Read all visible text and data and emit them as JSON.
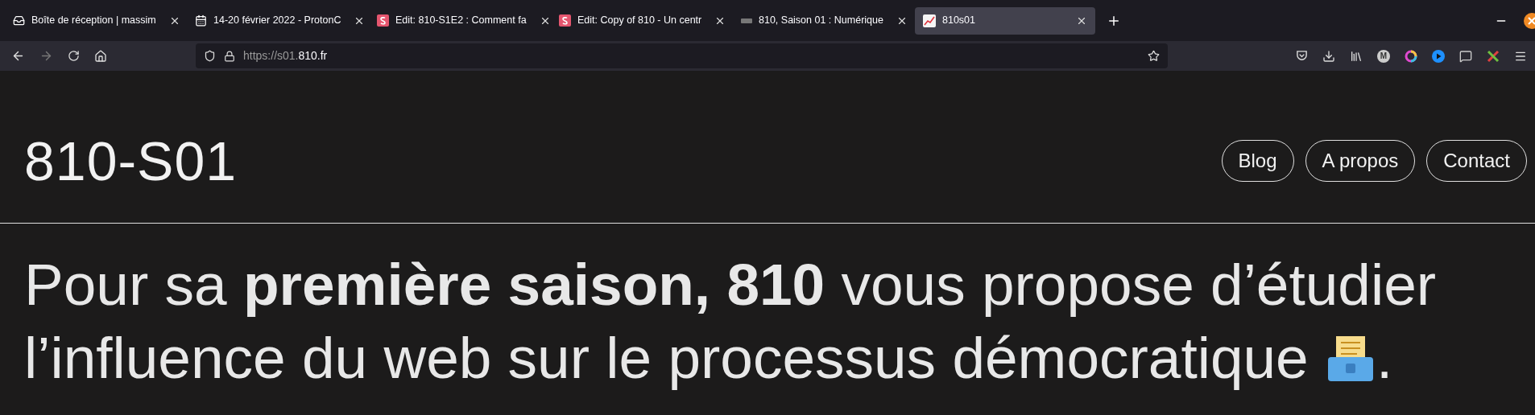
{
  "tabs": [
    {
      "title": "Boîte de réception | massim",
      "kind": "inbox",
      "selected": false
    },
    {
      "title": "14-20 février 2022 - ProtonC",
      "kind": "calendar",
      "selected": false
    },
    {
      "title": "Edit: 810-S1E2 : Comment fa",
      "kind": "s-logo",
      "selected": false
    },
    {
      "title": "Edit: Copy of 810 - Un centr",
      "kind": "s-logo",
      "selected": false
    },
    {
      "title": "810, Saison 01 : Numérique",
      "kind": "mini-logo",
      "selected": false
    },
    {
      "title": "810s01",
      "kind": "chart",
      "selected": true
    }
  ],
  "url": {
    "scheme": "https://s01.",
    "domain": "810.fr"
  },
  "extension_badge": "M",
  "site": {
    "title": "810-S01",
    "nav": [
      "Blog",
      "A propos",
      "Contact"
    ]
  },
  "intro": {
    "segments": [
      {
        "kind": "text",
        "text": "Pour sa **première saison, 810** vous propose d’étudier l’influence du web sur le processus démocratique "
      },
      {
        "kind": "ballot-icon"
      },
      {
        "kind": "text",
        "text": "."
      }
    ]
  }
}
